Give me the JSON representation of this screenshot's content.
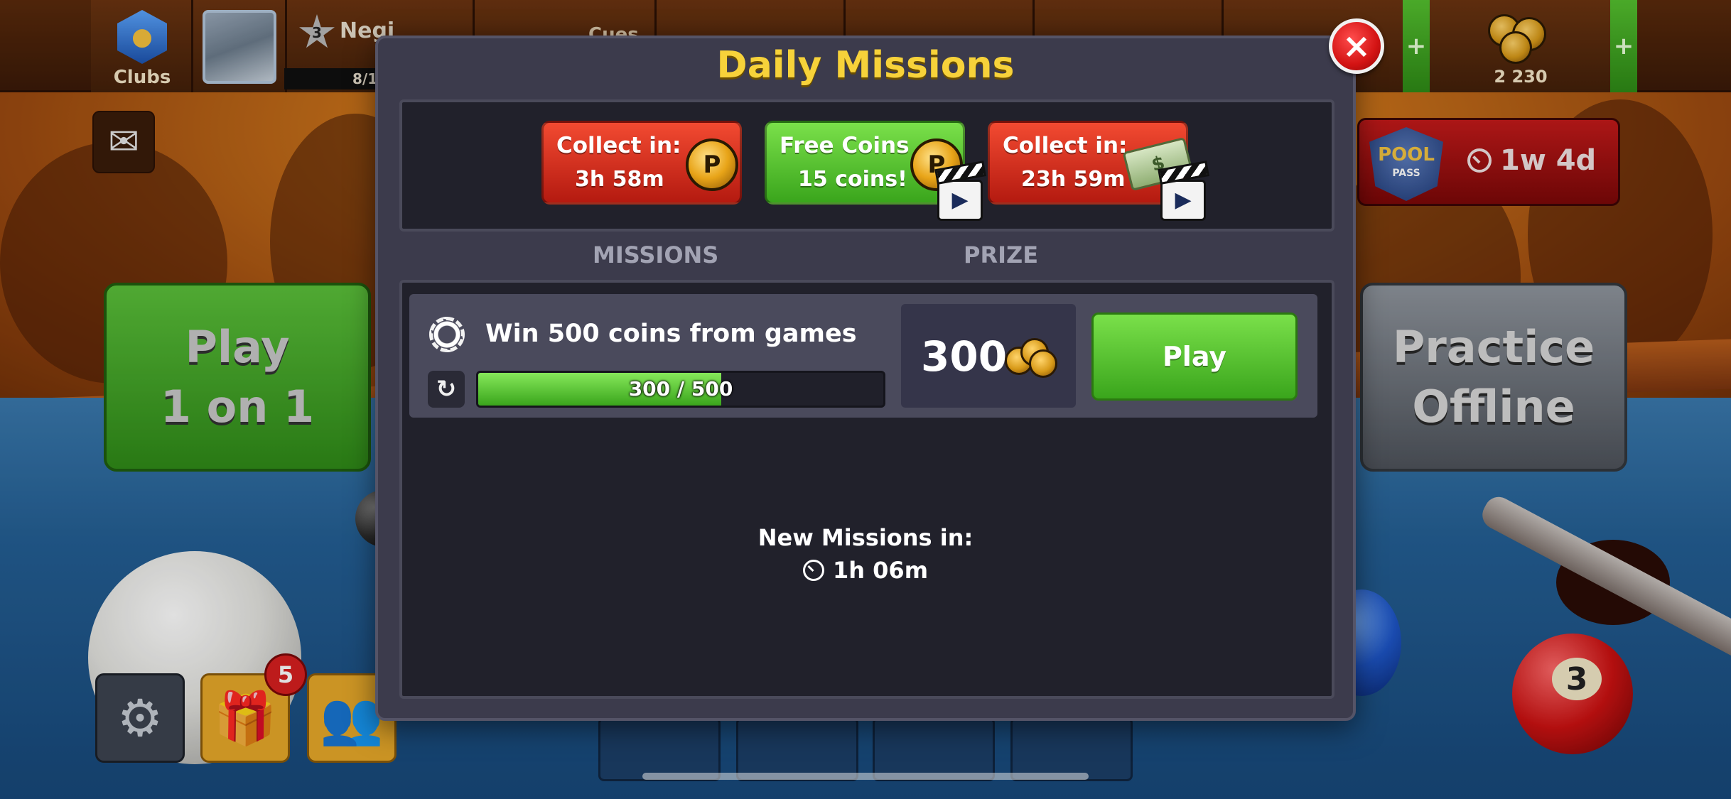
{
  "topbar": {
    "clubs_label": "Clubs",
    "player_name": "Negi",
    "player_level": "3",
    "xp_text": "8/1",
    "cues_label": "Cues",
    "coins_balance": "2 230",
    "plus_label": "+"
  },
  "pool_pass": {
    "badge_top": "POOL",
    "badge_bottom": "PASS",
    "timer": "1w 4d"
  },
  "main_buttons": {
    "play_1on1_line1": "Play",
    "play_1on1_line2": "1 on 1",
    "practice_line1": "Practice",
    "practice_line2": "Offline"
  },
  "bottom_bar": {
    "gift_badge_count": "5"
  },
  "dialog": {
    "title": "Daily Missions",
    "close_label": "×",
    "rewards": [
      {
        "line1": "Collect in:",
        "line2": "3h 58m",
        "color": "red",
        "icon": "coin-icon"
      },
      {
        "line1": "Free Coins",
        "line2": "15 coins!",
        "color": "green",
        "icon": "coin-icon",
        "video": true
      },
      {
        "line1": "Collect in:",
        "line2": "23h 59m",
        "color": "red",
        "icon": "cash-icon",
        "video": true
      }
    ],
    "columns": {
      "missions": "MISSIONS",
      "prize": "PRIZE"
    },
    "mission": {
      "text": "Win 500 coins from games",
      "progress_text": "300 / 500",
      "progress_fraction": 0.6,
      "prize_value": "300",
      "play_label": "Play"
    },
    "new_missions_label": "New Missions in:",
    "new_missions_timer": "1h 06m"
  },
  "colors": {
    "title_yellow": "#f7d23a",
    "reward_red": "#d8301f",
    "reward_green": "#5ccd34",
    "dialog_bg": "#3c3b4c",
    "panel_bg": "#21212b"
  }
}
